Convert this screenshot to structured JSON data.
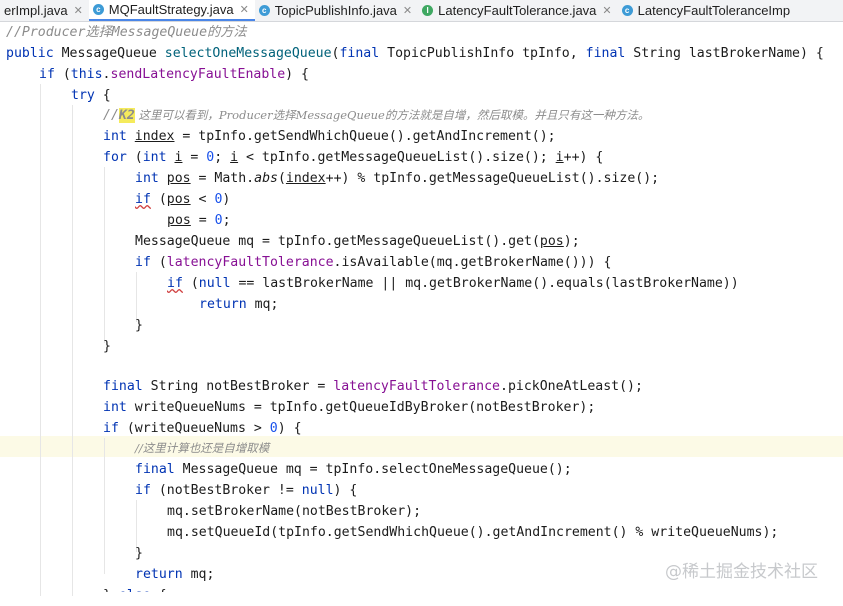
{
  "tabs": [
    {
      "label": "erImpl.java",
      "icon": "",
      "active": false
    },
    {
      "label": "MQFaultStrategy.java",
      "icon": "class-icon",
      "active": true
    },
    {
      "label": "TopicPublishInfo.java",
      "icon": "class-icon",
      "active": false
    },
    {
      "label": "LatencyFaultTolerance.java",
      "icon": "interface-icon",
      "active": false
    },
    {
      "label": "LatencyFaultToleranceImp",
      "icon": "class-icon",
      "active": false
    }
  ],
  "colors": {
    "keyword": "#0033b3",
    "field": "#871094",
    "method": "#00627a",
    "comment": "#8c8c8c",
    "number": "#1750eb",
    "class_icon": "#3d9bd6",
    "interface_icon": "#3fa862"
  },
  "code": {
    "l0": "//Producer选择MessageQueue的方法",
    "l1a": "public",
    "l1b": " MessageQueue ",
    "l1c": "selectOneMessageQueue",
    "l1d": "(",
    "l1e": "final",
    "l1f": " TopicPublishInfo tpInfo, ",
    "l1g": "final",
    "l1h": " String lastBrokerName) {",
    "l2a": "if",
    "l2b": " (",
    "l2c": "this",
    "l2d": ".",
    "l2e": "sendLatencyFaultEnable",
    "l2f": ") {",
    "l3a": "try",
    "l3b": " {",
    "l4a": "//",
    "l4b": "K2",
    "l4c": " 这里可以看到，Producer选择MessageQueue的方法就是自增，然后取模。并且只有这一种方法。",
    "l5a": "int",
    "l5b": " ",
    "l5c": "index",
    "l5d": " = tpInfo.getSendWhichQueue().getAndIncrement();",
    "l6a": "for",
    "l6b": " (",
    "l6c": "int",
    "l6d": " ",
    "l6e": "i",
    "l6f": " = ",
    "l6g": "0",
    "l6h": "; ",
    "l6i": "i",
    "l6j": " < tpInfo.getMessageQueueList().size(); ",
    "l6k": "i",
    "l6l": "++) {",
    "l7a": "int",
    "l7b": " ",
    "l7c": "pos",
    "l7d": " = Math.",
    "l7e": "abs",
    "l7f": "(",
    "l7g": "index",
    "l7h": "++) % tpInfo.getMessageQueueList().size();",
    "l8a": "if",
    "l8b": " (",
    "l8c": "pos",
    "l8d": " < ",
    "l8e": "0",
    "l8f": ")",
    "l9a": "pos",
    "l9b": " = ",
    "l9c": "0",
    "l9d": ";",
    "l10a": "MessageQueue mq = tpInfo.getMessageQueueList().get(",
    "l10b": "pos",
    "l10c": ");",
    "l11a": "if",
    "l11b": " (",
    "l11c": "latencyFaultTolerance",
    "l11d": ".isAvailable(mq.getBrokerName())) {",
    "l12a": "if",
    "l12b": " (",
    "l12c": "null",
    "l12d": " == lastBrokerName || mq.getBrokerName().equals(lastBrokerName))",
    "l13a": "return",
    "l13b": " mq;",
    "l14": "}",
    "l15": "}",
    "l16a": "final",
    "l16b": " String notBestBroker = ",
    "l16c": "latencyFaultTolerance",
    "l16d": ".pickOneAtLeast();",
    "l17a": "int",
    "l17b": " writeQueueNums = tpInfo.getQueueIdByBroker(notBestBroker);",
    "l18a": "if",
    "l18b": " (writeQueueNums > ",
    "l18c": "0",
    "l18d": ") {",
    "l19": "//这里计算也还是自增取模",
    "l20a": "final",
    "l20b": " MessageQueue mq = tpInfo.selectOneMessageQueue();",
    "l21a": "if",
    "l21b": " (notBestBroker != ",
    "l21c": "null",
    "l21d": ") {",
    "l22": "mq.setBrokerName(notBestBroker);",
    "l23a": "mq.setQueueId(tpInfo.getSendWhichQueue().getAndIncrement() % writeQueueNums);",
    "l24": "}",
    "l25a": "return",
    "l25b": " mq;",
    "l26a": "} ",
    "l26b": "else",
    "l26c": " {"
  },
  "watermark": "@稀土掘金技术社区"
}
